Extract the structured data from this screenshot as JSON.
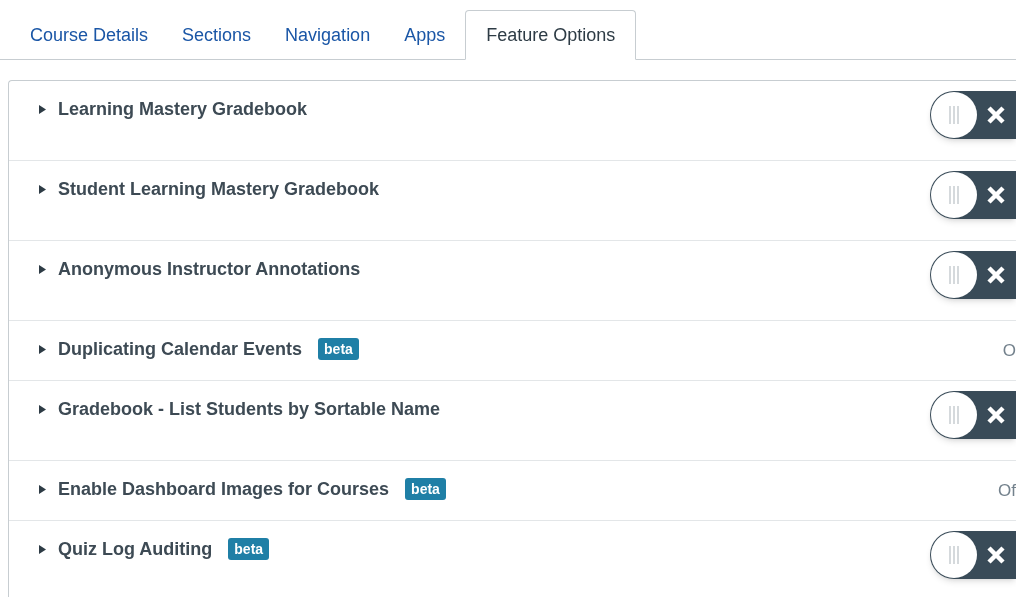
{
  "tabs": [
    {
      "label": "Course Details",
      "selected": false
    },
    {
      "label": "Sections",
      "selected": false
    },
    {
      "label": "Navigation",
      "selected": false
    },
    {
      "label": "Apps",
      "selected": false
    },
    {
      "label": "Feature Options",
      "selected": true
    }
  ],
  "features": [
    {
      "title": "Learning Mastery Gradebook",
      "kind": "toggle",
      "on": false
    },
    {
      "title": "Student Learning Mastery Gradebook",
      "kind": "toggle",
      "on": false
    },
    {
      "title": "Anonymous Instructor Annotations",
      "kind": "toggle",
      "on": false
    },
    {
      "title": "Duplicating Calendar Events",
      "badge": "beta",
      "kind": "status",
      "status": "O"
    },
    {
      "title": "Gradebook - List Students by Sortable Name",
      "kind": "toggle",
      "on": false
    },
    {
      "title": "Enable Dashboard Images for Courses",
      "badge": "beta",
      "kind": "status",
      "status": "Of"
    },
    {
      "title": "Quiz Log Auditing",
      "badge": "beta",
      "kind": "toggle",
      "on": false
    }
  ]
}
